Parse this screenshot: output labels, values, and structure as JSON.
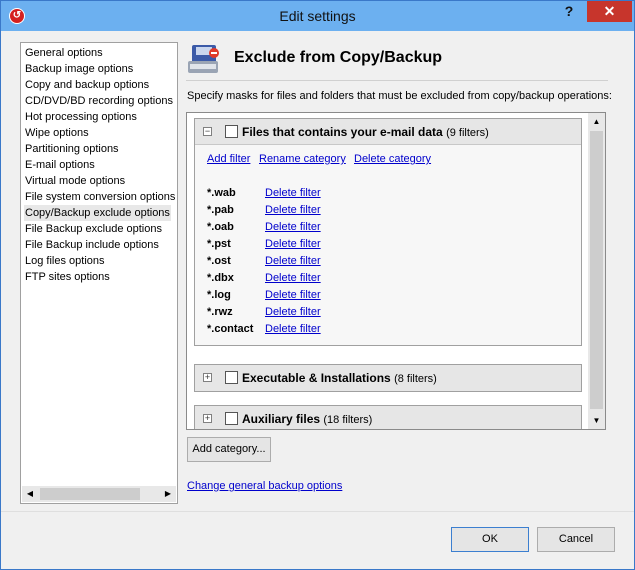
{
  "window": {
    "title": "Edit settings",
    "help_label": "?",
    "close_label": "✕"
  },
  "sidebar": {
    "items": [
      {
        "label": "General options"
      },
      {
        "label": "Backup image options"
      },
      {
        "label": "Copy and backup options"
      },
      {
        "label": "CD/DVD/BD recording options"
      },
      {
        "label": "Hot processing options"
      },
      {
        "label": "Wipe options"
      },
      {
        "label": "Partitioning options"
      },
      {
        "label": "E-mail options"
      },
      {
        "label": "Virtual mode options"
      },
      {
        "label": "File system conversion options"
      },
      {
        "label": "Copy/Backup exclude options"
      },
      {
        "label": "File Backup exclude options"
      },
      {
        "label": "File Backup include options"
      },
      {
        "label": "Log files options"
      },
      {
        "label": "FTP sites options"
      }
    ],
    "selected_index": 10
  },
  "main": {
    "title": "Exclude from Copy/Backup",
    "description": "Specify masks for files and folders that must be excluded from copy/backup operations:",
    "categories": [
      {
        "name": "Files that contains your e-mail data",
        "count": "(9 filters)",
        "expanded": true,
        "checked": false,
        "actions": {
          "add": "Add filter",
          "rename": "Rename category",
          "delete": "Delete category"
        },
        "filters": [
          {
            "mask": "*.wab",
            "delete": "Delete filter"
          },
          {
            "mask": "*.pab",
            "delete": "Delete filter"
          },
          {
            "mask": "*.oab",
            "delete": "Delete filter"
          },
          {
            "mask": "*.pst",
            "delete": "Delete filter"
          },
          {
            "mask": "*.ost",
            "delete": "Delete filter"
          },
          {
            "mask": "*.dbx",
            "delete": "Delete filter"
          },
          {
            "mask": "*.log",
            "delete": "Delete filter"
          },
          {
            "mask": "*.rwz",
            "delete": "Delete filter"
          },
          {
            "mask": "*.contact",
            "delete": "Delete filter"
          }
        ]
      },
      {
        "name": "Executable & Installations",
        "count": "(8 filters)",
        "expanded": false,
        "checked": false
      },
      {
        "name": "Auxiliary files",
        "count": "(18 filters)",
        "expanded": false,
        "checked": false
      }
    ],
    "add_category_label": "Add category...",
    "change_link": "Change general backup options"
  },
  "footer": {
    "ok_label": "OK",
    "cancel_label": "Cancel"
  },
  "colors": {
    "titlebar": "#6cb0f0",
    "close": "#c7352c",
    "link": "#0000cc"
  }
}
